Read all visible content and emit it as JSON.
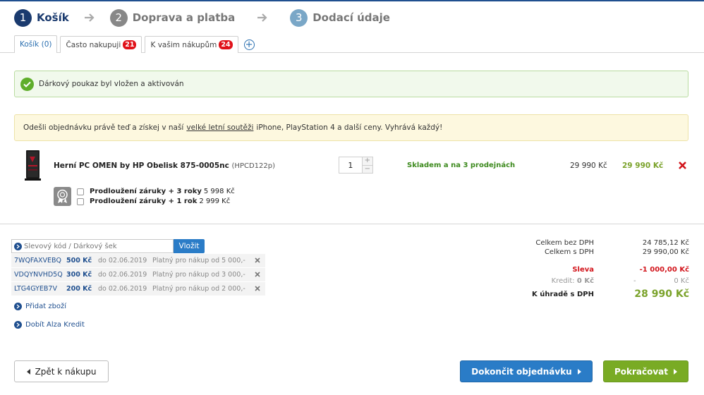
{
  "steps": [
    {
      "num": "1",
      "label": "Košík"
    },
    {
      "num": "2",
      "label": "Doprava a platba"
    },
    {
      "num": "3",
      "label": "Dodací údaje"
    }
  ],
  "tabs": [
    {
      "label": "Košík (0)"
    },
    {
      "label": "Často nakupuji",
      "badge": "21"
    },
    {
      "label": "K vašim nákupům",
      "badge": "24"
    }
  ],
  "alerts": {
    "success": "Dárkový poukaz byl vložen a aktivován",
    "info_before": "Odešli objednávku právě teď a získej v naší",
    "info_link": "velké letní soutěži",
    "info_after": "iPhone, PlayStation 4 a další ceny. Vyhrává každý!"
  },
  "product": {
    "name": "Herní PC OMEN by HP Obelisk 875-0005nc",
    "code": "(HPCD122p)",
    "qty": "1",
    "stock": "Skladem a na 3 prodejnách",
    "price": "29 990 Kč",
    "total": "29 990 Kč",
    "warranties": [
      {
        "label": "Prodloužení záruky + 3 roky",
        "price": "5 998 Kč"
      },
      {
        "label": "Prodloužení záruky + 1 rok",
        "price": "2 999 Kč"
      }
    ]
  },
  "voucher": {
    "placeholder": "Slevový kód / Dárkový šek",
    "apply_label": "Vložit",
    "items": [
      {
        "code": "7WQFAXVEBQ",
        "amount": "500 Kč",
        "date": "do 02.06.2019",
        "note": "Platný pro nákup od 5 000,-"
      },
      {
        "code": "VDQYNVHD5Q",
        "amount": "300 Kč",
        "date": "do 02.06.2019",
        "note": "Platný pro nákup od 3 000,-"
      },
      {
        "code": "LTG4GYEB7V",
        "amount": "200 Kč",
        "date": "do 02.06.2019",
        "note": "Platný pro nákup od 2 000,-"
      }
    ]
  },
  "links": {
    "add_goods": "Přidat zboží",
    "top_up": "Dobít Alza Kredit"
  },
  "summary": {
    "without_vat_label": "Celkem bez DPH",
    "without_vat_value": "24 785,12 Kč",
    "with_vat_label": "Celkem s DPH",
    "with_vat_value": "29 990,00 Kč",
    "discount_label": "Sleva",
    "discount_value": "-1 000,00 Kč",
    "credit_label": "Kredit:",
    "credit_amount": "0 Kč",
    "credit_dash": "-",
    "credit_value": "0 Kč",
    "to_pay_label": "K úhradě s DPH",
    "to_pay_value": "28 990 Kč"
  },
  "buttons": {
    "back": "Zpět k nákupu",
    "finish": "Dokončit objednávku",
    "continue": "Pokračovat"
  }
}
